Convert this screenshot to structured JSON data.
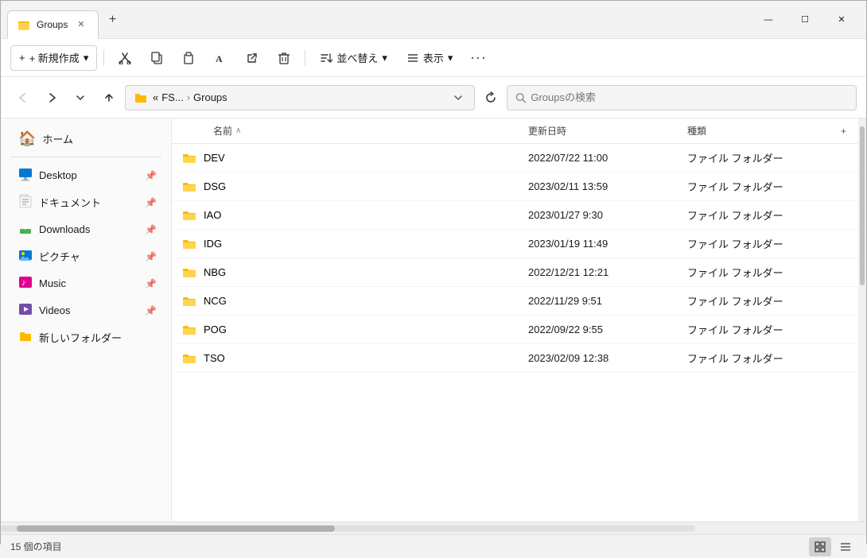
{
  "titlebar": {
    "tab_title": "Groups",
    "add_tab_label": "+",
    "minimize_label": "—",
    "maximize_label": "☐",
    "close_label": "✕"
  },
  "toolbar": {
    "new_item_label": "+ 新規作成",
    "new_item_chevron": "▾",
    "cut_icon": "✂",
    "copy_icon": "⧉",
    "paste_icon": "📋",
    "rename_icon": "Ａ",
    "share_icon": "↗",
    "delete_icon": "🗑",
    "sort_label": "並べ替え",
    "sort_icon": "⇅",
    "view_label": "表示",
    "view_icon": "≡",
    "more_icon": "···"
  },
  "addressbar": {
    "back_icon": "←",
    "forward_icon": "→",
    "dropdown_icon": "˅",
    "up_icon": "↑",
    "breadcrumb_prefix": "«",
    "breadcrumb_short": "FS...",
    "breadcrumb_separator": "›",
    "breadcrumb_current": "Groups",
    "expand_icon": "˅",
    "refresh_icon": "↻",
    "search_placeholder": "Groupsの検索",
    "search_icon": "🔍"
  },
  "sidebar": {
    "home_label": "ホーム",
    "items": [
      {
        "label": "Desktop",
        "icon": "desktop",
        "pinned": true
      },
      {
        "label": "ドキュメント",
        "icon": "document",
        "pinned": true
      },
      {
        "label": "Downloads",
        "icon": "downloads",
        "pinned": true
      },
      {
        "label": "ピクチャ",
        "icon": "picture",
        "pinned": true
      },
      {
        "label": "Music",
        "icon": "music",
        "pinned": true
      },
      {
        "label": "Videos",
        "icon": "videos",
        "pinned": true
      },
      {
        "label": "新しいフォルダー",
        "icon": "folder",
        "pinned": false
      }
    ]
  },
  "filelist": {
    "col_name": "名前",
    "col_date": "更新日時",
    "col_type": "種類",
    "col_plus": "+",
    "sort_asc": "∧",
    "rows": [
      {
        "name": "DEV",
        "date": "2022/07/22 11:00",
        "type": "ファイル フォルダー"
      },
      {
        "name": "DSG",
        "date": "2023/02/11 13:59",
        "type": "ファイル フォルダー"
      },
      {
        "name": "IAO",
        "date": "2023/01/27 9:30",
        "type": "ファイル フォルダー"
      },
      {
        "name": "IDG",
        "date": "2023/01/19 11:49",
        "type": "ファイル フォルダー"
      },
      {
        "name": "NBG",
        "date": "2022/12/21 12:21",
        "type": "ファイル フォルダー"
      },
      {
        "name": "NCG",
        "date": "2022/11/29 9:51",
        "type": "ファイル フォルダー"
      },
      {
        "name": "POG",
        "date": "2022/09/22 9:55",
        "type": "ファイル フォルダー"
      },
      {
        "name": "TSO",
        "date": "2023/02/09 12:38",
        "type": "ファイル フォルダー"
      }
    ]
  },
  "statusbar": {
    "count_label": "15 個の項目",
    "grid_view_icon": "⊞",
    "list_view_icon": "☰"
  }
}
